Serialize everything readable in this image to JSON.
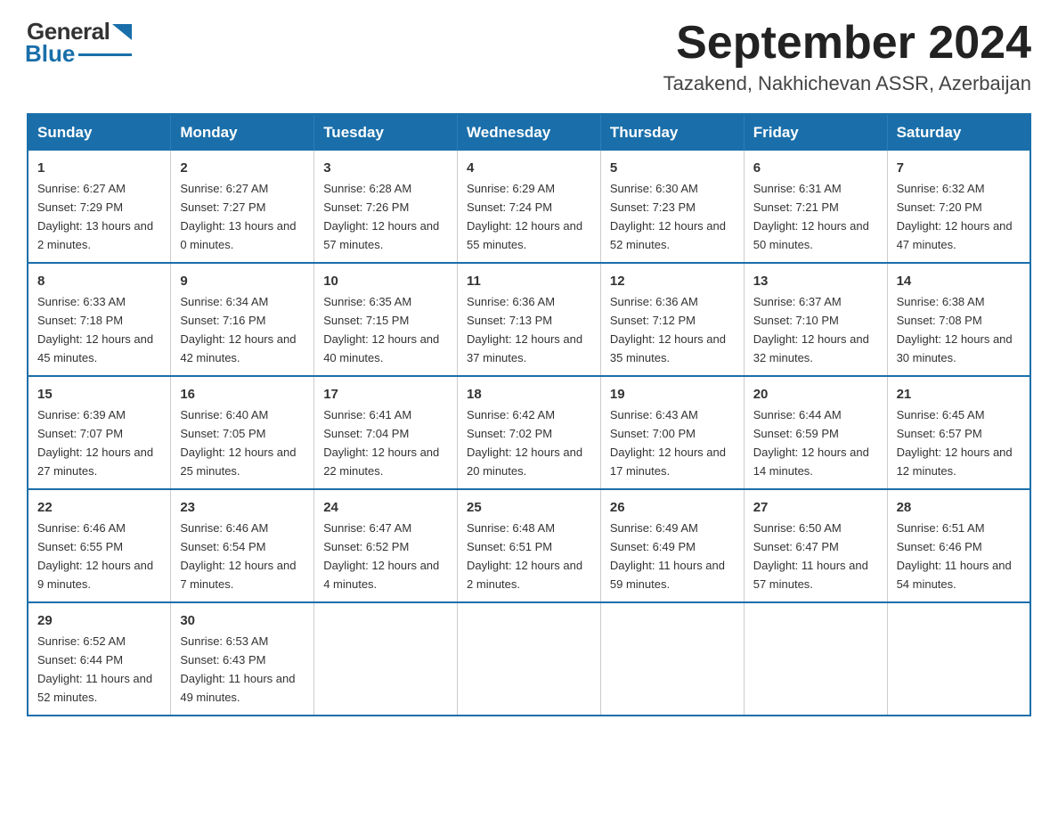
{
  "logo": {
    "general": "General",
    "blue": "Blue"
  },
  "title": "September 2024",
  "location": "Tazakend, Nakhichevan ASSR, Azerbaijan",
  "days_of_week": [
    "Sunday",
    "Monday",
    "Tuesday",
    "Wednesday",
    "Thursday",
    "Friday",
    "Saturday"
  ],
  "weeks": [
    [
      {
        "day": 1,
        "sunrise": "6:27 AM",
        "sunset": "7:29 PM",
        "daylight": "13 hours and 2 minutes."
      },
      {
        "day": 2,
        "sunrise": "6:27 AM",
        "sunset": "7:27 PM",
        "daylight": "13 hours and 0 minutes."
      },
      {
        "day": 3,
        "sunrise": "6:28 AM",
        "sunset": "7:26 PM",
        "daylight": "12 hours and 57 minutes."
      },
      {
        "day": 4,
        "sunrise": "6:29 AM",
        "sunset": "7:24 PM",
        "daylight": "12 hours and 55 minutes."
      },
      {
        "day": 5,
        "sunrise": "6:30 AM",
        "sunset": "7:23 PM",
        "daylight": "12 hours and 52 minutes."
      },
      {
        "day": 6,
        "sunrise": "6:31 AM",
        "sunset": "7:21 PM",
        "daylight": "12 hours and 50 minutes."
      },
      {
        "day": 7,
        "sunrise": "6:32 AM",
        "sunset": "7:20 PM",
        "daylight": "12 hours and 47 minutes."
      }
    ],
    [
      {
        "day": 8,
        "sunrise": "6:33 AM",
        "sunset": "7:18 PM",
        "daylight": "12 hours and 45 minutes."
      },
      {
        "day": 9,
        "sunrise": "6:34 AM",
        "sunset": "7:16 PM",
        "daylight": "12 hours and 42 minutes."
      },
      {
        "day": 10,
        "sunrise": "6:35 AM",
        "sunset": "7:15 PM",
        "daylight": "12 hours and 40 minutes."
      },
      {
        "day": 11,
        "sunrise": "6:36 AM",
        "sunset": "7:13 PM",
        "daylight": "12 hours and 37 minutes."
      },
      {
        "day": 12,
        "sunrise": "6:36 AM",
        "sunset": "7:12 PM",
        "daylight": "12 hours and 35 minutes."
      },
      {
        "day": 13,
        "sunrise": "6:37 AM",
        "sunset": "7:10 PM",
        "daylight": "12 hours and 32 minutes."
      },
      {
        "day": 14,
        "sunrise": "6:38 AM",
        "sunset": "7:08 PM",
        "daylight": "12 hours and 30 minutes."
      }
    ],
    [
      {
        "day": 15,
        "sunrise": "6:39 AM",
        "sunset": "7:07 PM",
        "daylight": "12 hours and 27 minutes."
      },
      {
        "day": 16,
        "sunrise": "6:40 AM",
        "sunset": "7:05 PM",
        "daylight": "12 hours and 25 minutes."
      },
      {
        "day": 17,
        "sunrise": "6:41 AM",
        "sunset": "7:04 PM",
        "daylight": "12 hours and 22 minutes."
      },
      {
        "day": 18,
        "sunrise": "6:42 AM",
        "sunset": "7:02 PM",
        "daylight": "12 hours and 20 minutes."
      },
      {
        "day": 19,
        "sunrise": "6:43 AM",
        "sunset": "7:00 PM",
        "daylight": "12 hours and 17 minutes."
      },
      {
        "day": 20,
        "sunrise": "6:44 AM",
        "sunset": "6:59 PM",
        "daylight": "12 hours and 14 minutes."
      },
      {
        "day": 21,
        "sunrise": "6:45 AM",
        "sunset": "6:57 PM",
        "daylight": "12 hours and 12 minutes."
      }
    ],
    [
      {
        "day": 22,
        "sunrise": "6:46 AM",
        "sunset": "6:55 PM",
        "daylight": "12 hours and 9 minutes."
      },
      {
        "day": 23,
        "sunrise": "6:46 AM",
        "sunset": "6:54 PM",
        "daylight": "12 hours and 7 minutes."
      },
      {
        "day": 24,
        "sunrise": "6:47 AM",
        "sunset": "6:52 PM",
        "daylight": "12 hours and 4 minutes."
      },
      {
        "day": 25,
        "sunrise": "6:48 AM",
        "sunset": "6:51 PM",
        "daylight": "12 hours and 2 minutes."
      },
      {
        "day": 26,
        "sunrise": "6:49 AM",
        "sunset": "6:49 PM",
        "daylight": "11 hours and 59 minutes."
      },
      {
        "day": 27,
        "sunrise": "6:50 AM",
        "sunset": "6:47 PM",
        "daylight": "11 hours and 57 minutes."
      },
      {
        "day": 28,
        "sunrise": "6:51 AM",
        "sunset": "6:46 PM",
        "daylight": "11 hours and 54 minutes."
      }
    ],
    [
      {
        "day": 29,
        "sunrise": "6:52 AM",
        "sunset": "6:44 PM",
        "daylight": "11 hours and 52 minutes."
      },
      {
        "day": 30,
        "sunrise": "6:53 AM",
        "sunset": "6:43 PM",
        "daylight": "11 hours and 49 minutes."
      },
      null,
      null,
      null,
      null,
      null
    ]
  ]
}
